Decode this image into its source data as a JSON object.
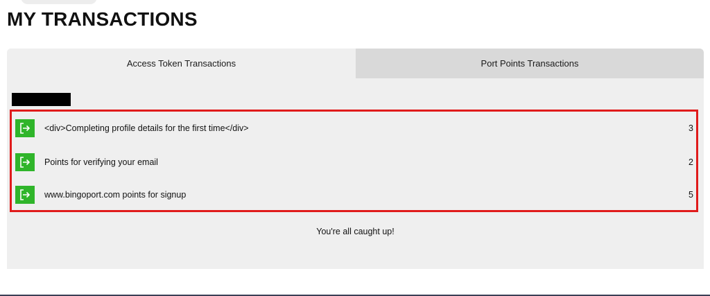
{
  "page": {
    "title": "MY TRANSACTIONS"
  },
  "tabs": [
    {
      "label": "Access Token Transactions",
      "active": true
    },
    {
      "label": "Port Points Transactions",
      "active": false
    }
  ],
  "transactions": [
    {
      "description": "<div>Completing profile details for the first time</div>",
      "points": "3",
      "icon": "sign-out-arrow-icon"
    },
    {
      "description": "Points for verifying your email",
      "points": "2",
      "icon": "sign-out-arrow-icon"
    },
    {
      "description": "www.bingoport.com points for signup",
      "points": "5",
      "icon": "sign-out-arrow-icon"
    }
  ],
  "footer": {
    "status_text": "You're all caught up!"
  },
  "colors": {
    "accent_green": "#2fb52a",
    "highlight_red": "#e01b1b",
    "panel_bg": "#efefef",
    "inactive_tab_bg": "#d9d9d9"
  }
}
